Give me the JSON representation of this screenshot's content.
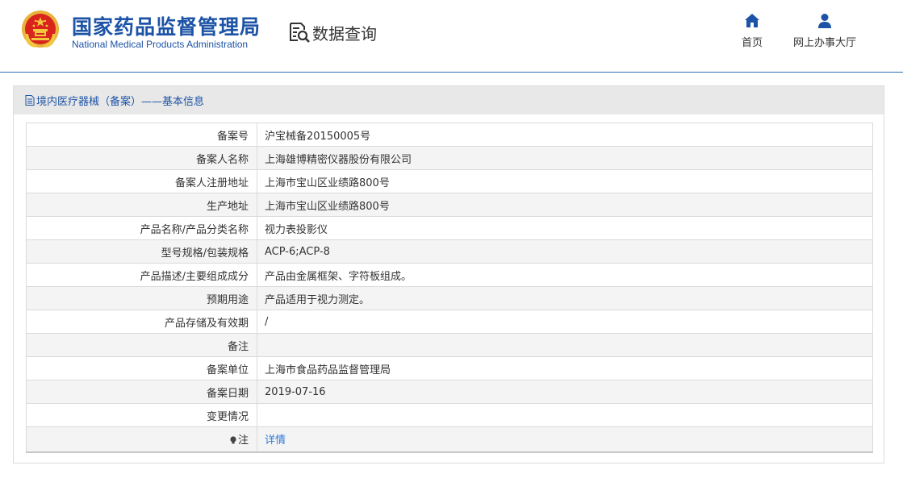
{
  "header": {
    "brand_cn": "国家药品监督管理局",
    "brand_en": "National Medical Products Administration",
    "query_title": "数据查询",
    "nav": {
      "home_label": "首页",
      "hall_label": "网上办事大厅"
    }
  },
  "panel": {
    "title": "境内医疗器械（备案）——基本信息"
  },
  "rows": [
    {
      "key": "备案号",
      "value": "沪宝械备20150005号"
    },
    {
      "key": "备案人名称",
      "value": "上海雄博精密仪器股份有限公司"
    },
    {
      "key": "备案人注册地址",
      "value": "上海市宝山区业绩路800号"
    },
    {
      "key": "生产地址",
      "value": "上海市宝山区业绩路800号"
    },
    {
      "key": "产品名称/产品分类名称",
      "value": "视力表投影仪"
    },
    {
      "key": "型号规格/包装规格",
      "value": "ACP-6;ACP-8"
    },
    {
      "key": "产品描述/主要组成成分",
      "value": "产品由金属框架、字符板组成。"
    },
    {
      "key": "预期用途",
      "value": "产品适用于视力测定。"
    },
    {
      "key": "产品存储及有效期",
      "value": "/"
    },
    {
      "key": "备注",
      "value": ""
    },
    {
      "key": "备案单位",
      "value": "上海市食品药品监督管理局"
    },
    {
      "key": "备案日期",
      "value": "2019-07-16"
    },
    {
      "key": "变更情况",
      "value": ""
    }
  ],
  "note": {
    "key": "注",
    "link": "详情"
  },
  "colors": {
    "brand": "#1c53a6",
    "link": "#2d7ad6",
    "emblem_red": "#d8241c",
    "emblem_gold": "#f3c63f"
  },
  "icons": {
    "logo": "national-emblem-icon",
    "query": "document-search-icon",
    "home": "home-icon",
    "hall": "user-icon",
    "title": "document-icon",
    "note": "lightbulb-icon"
  }
}
